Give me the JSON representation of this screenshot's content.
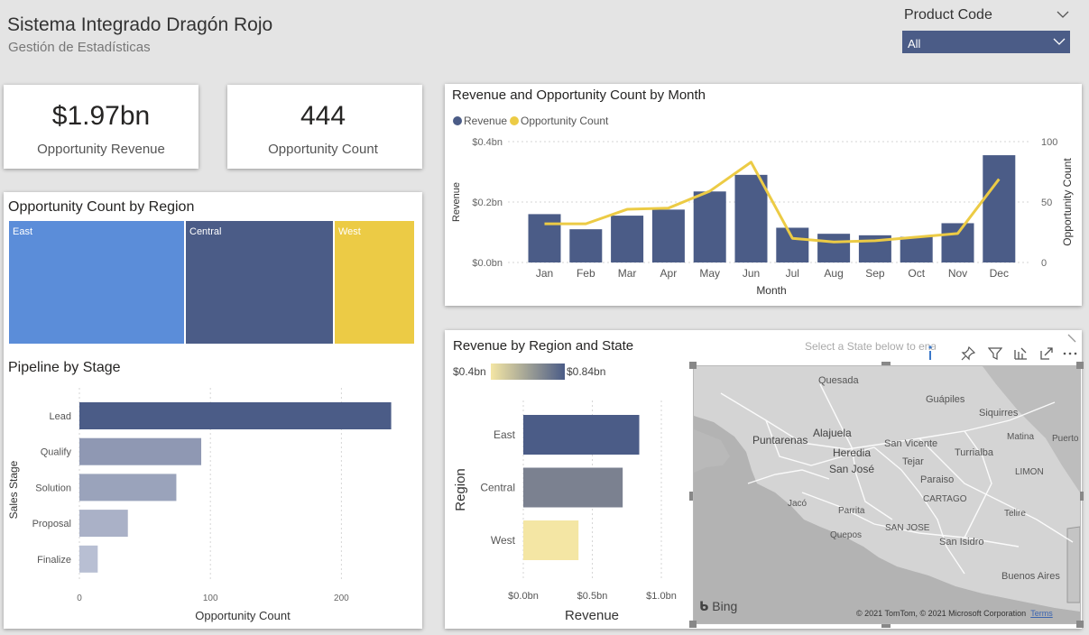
{
  "header": {
    "title": "Sistema Integrado Dragón Rojo",
    "subtitle": "Gestión de Estadísticas"
  },
  "filter": {
    "label": "Product Code",
    "selected": "All"
  },
  "kpis": [
    {
      "value": "$1.97bn",
      "label": "Opportunity Revenue"
    },
    {
      "value": "444",
      "label": "Opportunity Count"
    }
  ],
  "treemap": {
    "title": "Opportunity Count by Region",
    "tiles": [
      {
        "label": "East",
        "color": "#5b8dd9"
      },
      {
        "label": "Central",
        "color": "#4b5c87"
      },
      {
        "label": "West",
        "color": "#eccb45"
      }
    ]
  },
  "pipeline": {
    "title": "Pipeline by Stage"
  },
  "monthly": {
    "title": "Revenue and Opportunity Count by Month"
  },
  "region_state": {
    "title": "Revenue by Region and State",
    "gradient_min": "$0.4bn",
    "gradient_max": "$0.84bn",
    "hint": "Select a State below to enable"
  },
  "map": {
    "attribution": "© 2021 TomTom, © 2021 Microsoft Corporation",
    "terms": "Terms",
    "provider": "Bing",
    "places": [
      "Quesada",
      "Guápiles",
      "Siquirres",
      "Alajuela",
      "Puntarenas",
      "Heredia",
      "San Vicente",
      "Turrialba",
      "Matina",
      "Puerto",
      "San José",
      "Tejar",
      "LIMON",
      "Paraiso",
      "CARTAGO",
      "Jacó",
      "Parrita",
      "Telire",
      "SAN JOSE",
      "Quepos",
      "San Isidro",
      "Buenos Aires"
    ]
  },
  "chart_data": [
    {
      "type": "bar",
      "title": "Pipeline by Stage",
      "orientation": "horizontal",
      "categories": [
        "Lead",
        "Qualify",
        "Solution",
        "Proposal",
        "Finalize"
      ],
      "values": [
        238,
        93,
        74,
        37,
        14
      ],
      "colors": [
        "#4b5c87",
        "#8f98b3",
        "#9aa3bb",
        "#aab1c7",
        "#b8bfd3"
      ],
      "xlabel": "Opportunity Count",
      "ylabel": "Sales Stage",
      "xticks": [
        "0",
        "100",
        "200"
      ],
      "xlim": [
        0,
        260
      ]
    },
    {
      "type": "bar+line",
      "title": "Revenue and Opportunity Count by Month",
      "categories": [
        "Jan",
        "Feb",
        "Mar",
        "Apr",
        "May",
        "Jun",
        "Jul",
        "Aug",
        "Sep",
        "Oct",
        "Nov",
        "Dec"
      ],
      "series": [
        {
          "name": "Revenue",
          "type": "bar",
          "axis": "left",
          "color": "#4b5c87",
          "values": [
            0.16,
            0.11,
            0.155,
            0.175,
            0.235,
            0.29,
            0.115,
            0.095,
            0.09,
            0.085,
            0.13,
            0.355
          ]
        },
        {
          "name": "Opportunity Count",
          "type": "line",
          "axis": "right",
          "color": "#eccb45",
          "values": [
            32,
            32,
            44,
            45,
            59,
            83,
            20,
            17,
            18,
            21,
            24,
            69
          ]
        }
      ],
      "xlabel": "Month",
      "ylabel": "Revenue",
      "y2label": "Opportunity Count",
      "yticks": [
        "$0.0bn",
        "$0.2bn",
        "$0.4bn"
      ],
      "y2ticks": [
        "0",
        "50",
        "100"
      ],
      "ylim": [
        0,
        0.4
      ],
      "y2lim": [
        0,
        100
      ],
      "legend": "top-left"
    },
    {
      "type": "bar",
      "title": "Revenue by Region and State",
      "orientation": "horizontal",
      "categories": [
        "East",
        "Central",
        "West"
      ],
      "values": [
        0.84,
        0.72,
        0.4
      ],
      "colors": [
        "#4b5c87",
        "#7b8190",
        "#f4e6a4"
      ],
      "xlabel": "Revenue",
      "ylabel": "Region",
      "xticks": [
        "$0.0bn",
        "$0.5bn",
        "$1.0bn"
      ],
      "xlim": [
        0,
        1.0
      ]
    }
  ]
}
